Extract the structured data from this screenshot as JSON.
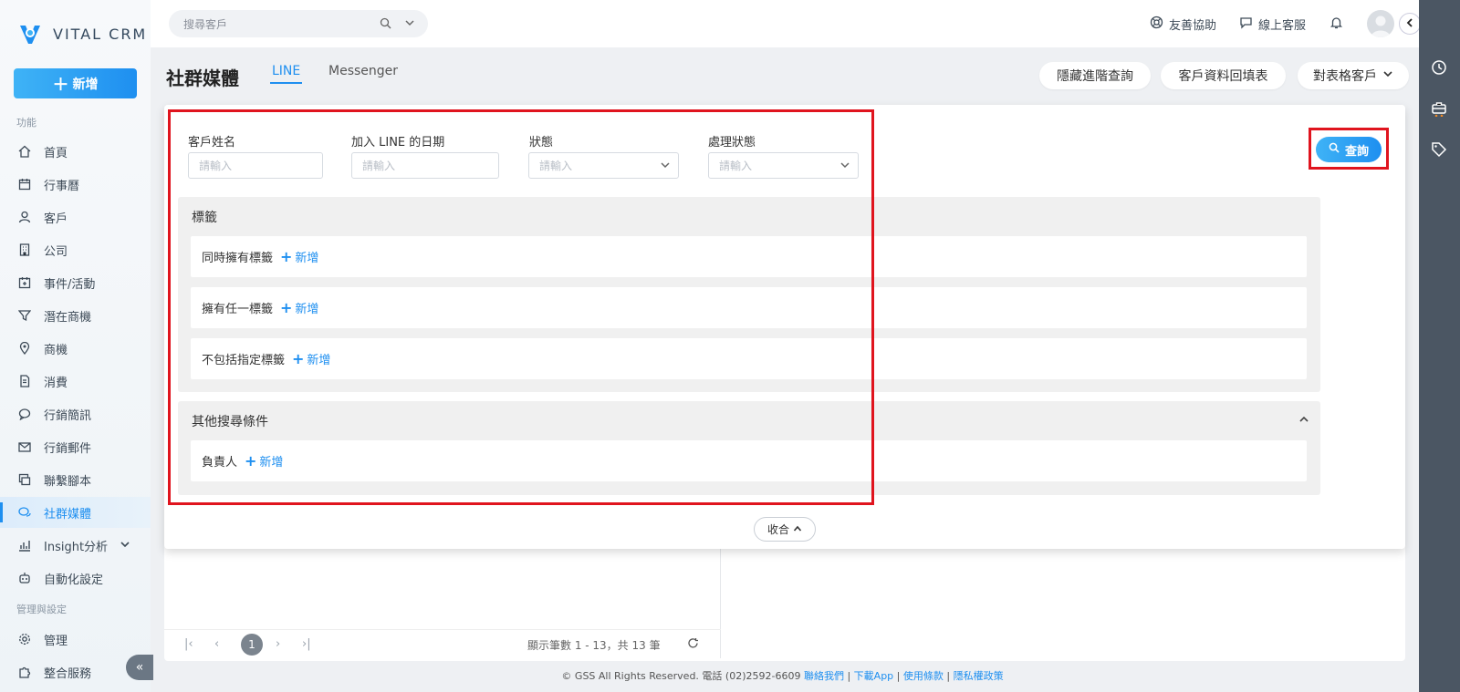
{
  "app": {
    "logo_text": "VITAL CRM",
    "new_button": "新增"
  },
  "sidebar": {
    "section_features": "功能",
    "section_admin": "管理與設定",
    "items": [
      {
        "label": "首頁"
      },
      {
        "label": "行事曆"
      },
      {
        "label": "客戶"
      },
      {
        "label": "公司"
      },
      {
        "label": "事件/活動"
      },
      {
        "label": "潛在商機"
      },
      {
        "label": "商機"
      },
      {
        "label": "消費"
      },
      {
        "label": "行銷簡訊"
      },
      {
        "label": "行銷郵件"
      },
      {
        "label": "聯繫腳本"
      },
      {
        "label": "社群媒體"
      },
      {
        "label": "Insight分析"
      },
      {
        "label": "自動化設定"
      }
    ],
    "admin_items": [
      {
        "label": "管理"
      },
      {
        "label": "整合服務"
      }
    ]
  },
  "topbar": {
    "search_placeholder": "搜尋客戶",
    "help_label": "友善協助",
    "support_label": "線上客服"
  },
  "page": {
    "title": "社群媒體",
    "tabs": [
      {
        "label": "LINE"
      },
      {
        "label": "Messenger"
      }
    ],
    "buttons": {
      "hide_advanced": "隱藏進階查詢",
      "customer_form": "客戶資料回填表",
      "table_customers": "對表格客戶"
    }
  },
  "filters": {
    "name_label": "客戶姓名",
    "name_placeholder": "請輸入",
    "date_label": "加入 LINE 的日期",
    "date_placeholder": "請輸入",
    "status_label": "狀態",
    "status_placeholder": "請輸入",
    "process_label": "處理狀態",
    "process_placeholder": "請輸入",
    "query_button": "查詢"
  },
  "tags_group": {
    "title": "標籤",
    "rows": [
      {
        "label": "同時擁有標籤",
        "add": "新增"
      },
      {
        "label": "擁有任一標籤",
        "add": "新增"
      },
      {
        "label": "不包括指定標籤",
        "add": "新增"
      }
    ]
  },
  "other_group": {
    "title": "其他搜尋條件",
    "rows": [
      {
        "label": "負責人",
        "add": "新增"
      }
    ]
  },
  "collapse_label": "收合",
  "pager": {
    "current": "1",
    "info": "顯示筆數 1 - 13，共 13 筆"
  },
  "footer": {
    "copyright": "© GSS All Rights Reserved. 電話 (02)2592-6609",
    "links": [
      "聯絡我們",
      "下載App",
      "使用條款",
      "隱私權政策"
    ]
  },
  "colors": {
    "accent": "#1e8ff0",
    "highlight": "#e0141e",
    "rail": "#4b5663"
  }
}
